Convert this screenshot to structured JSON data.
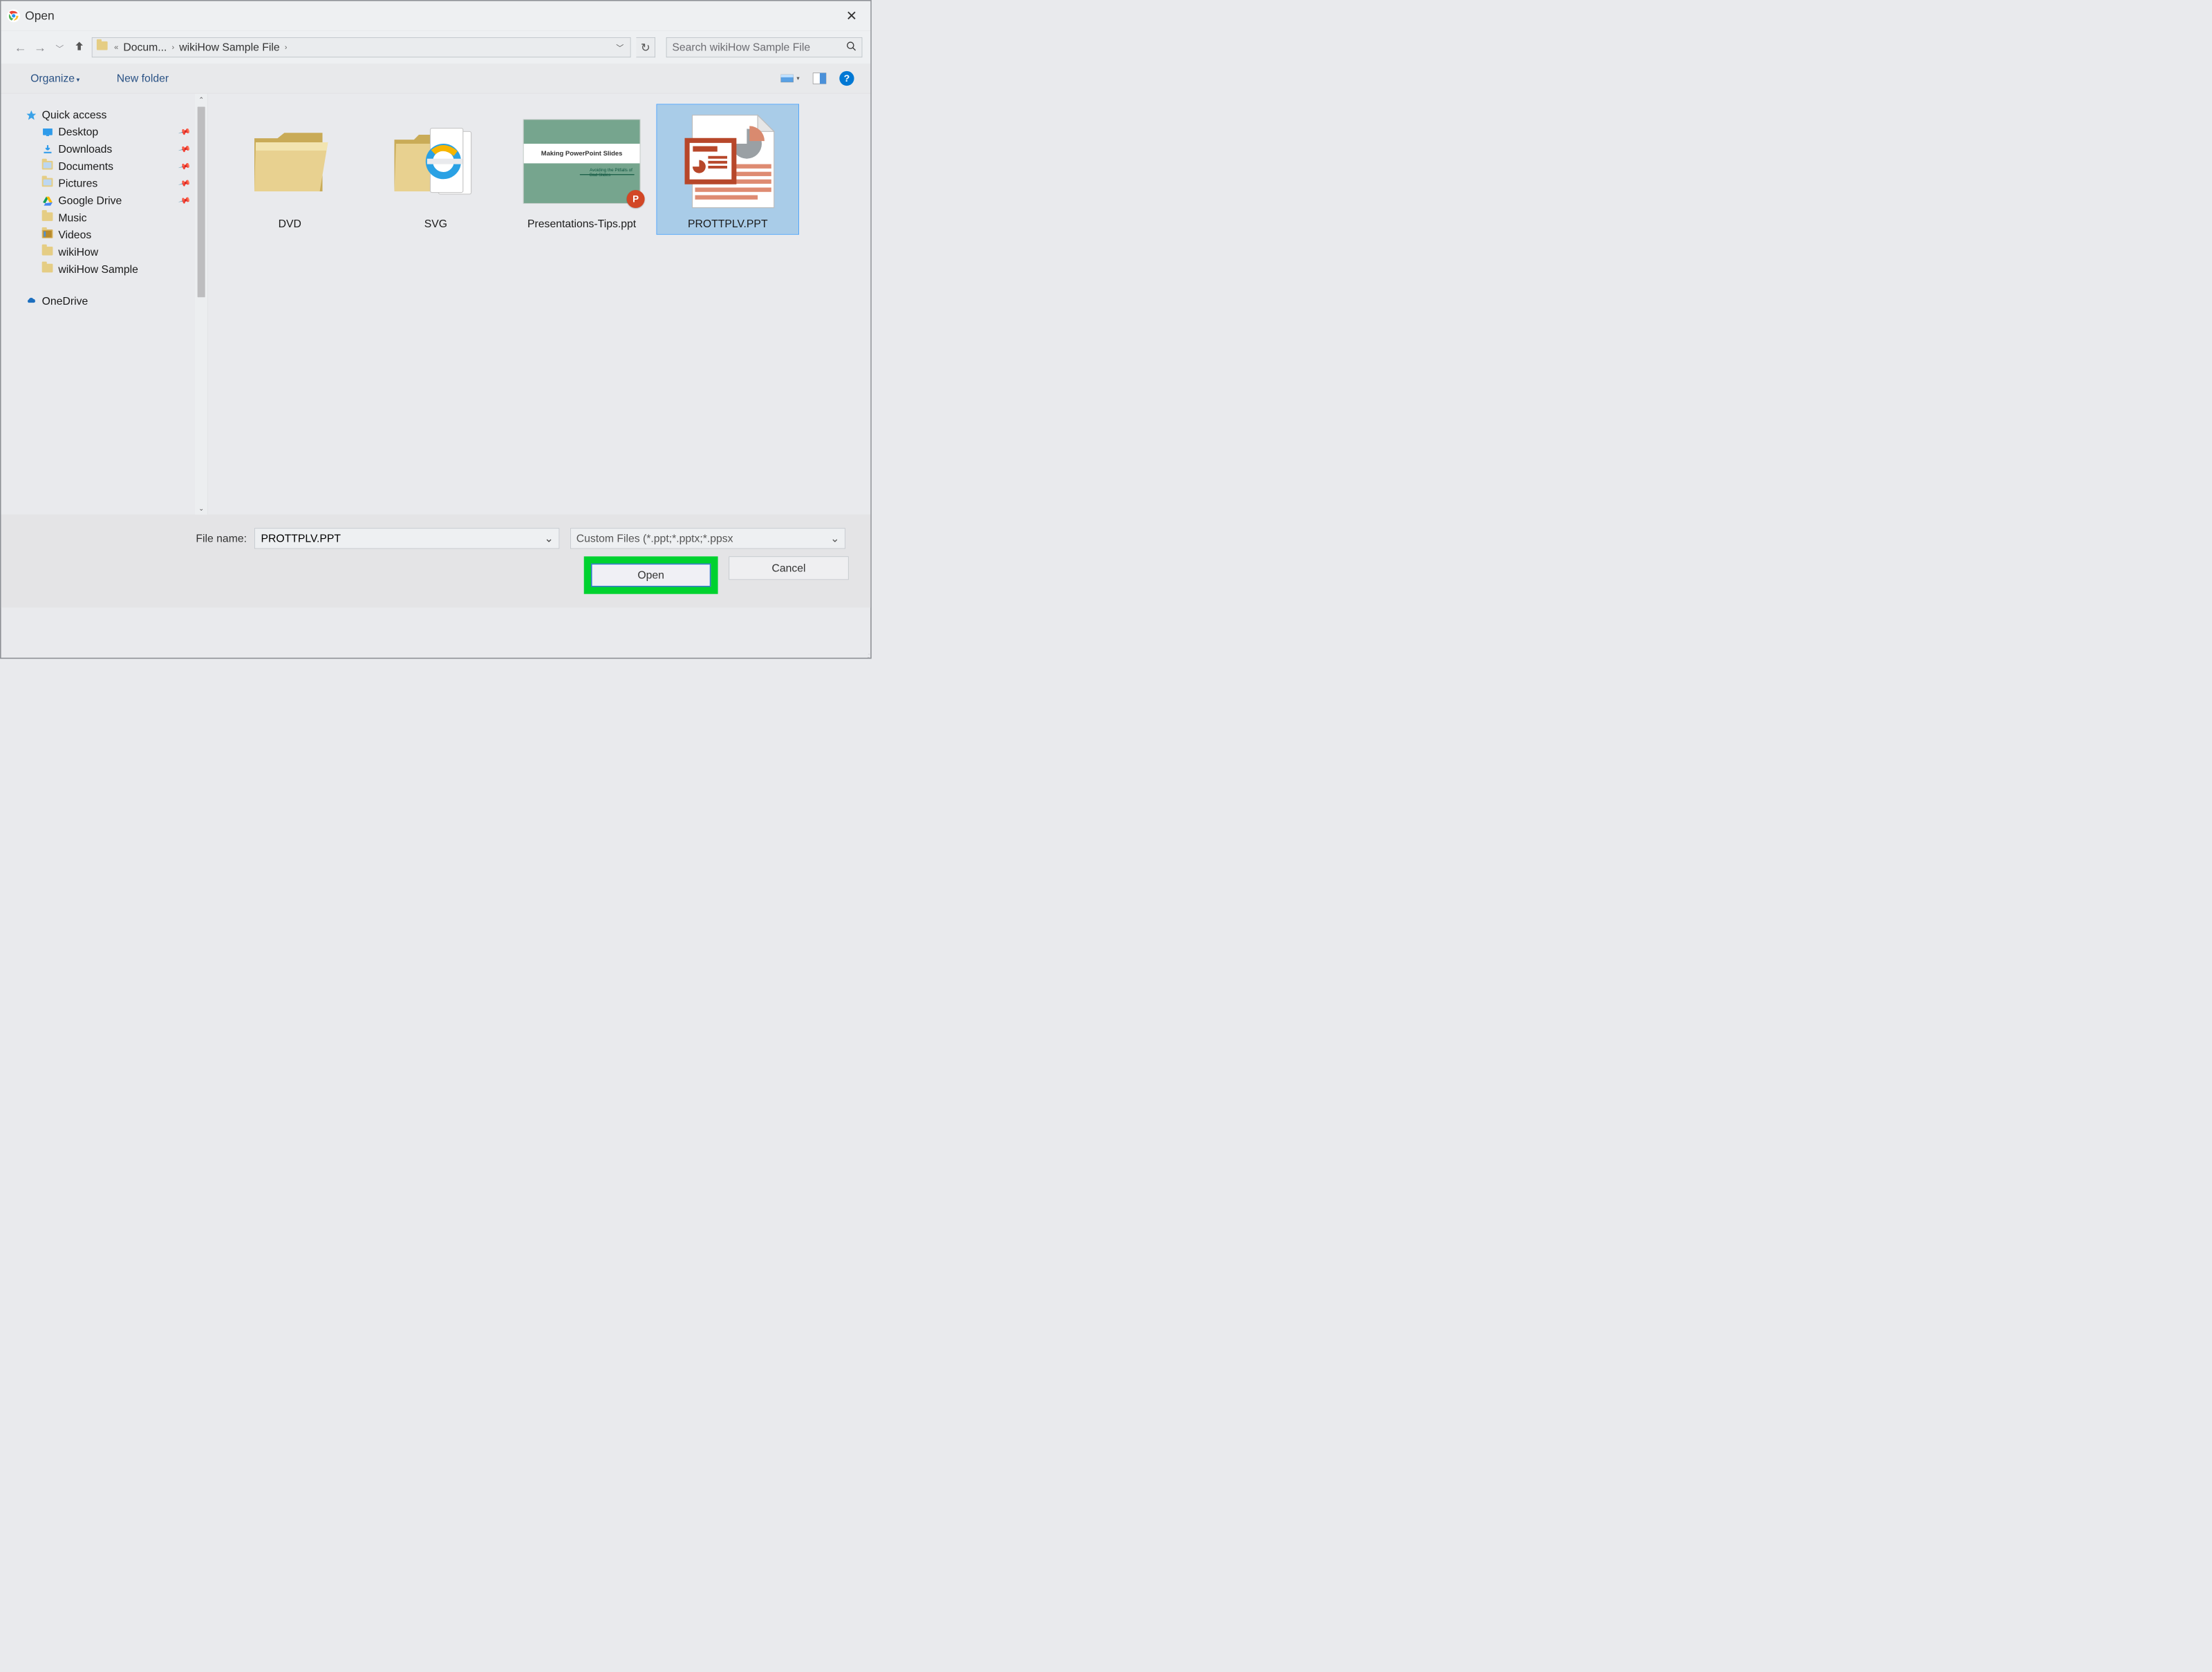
{
  "window": {
    "title": "Open"
  },
  "breadcrumb": {
    "seg1": "Docum...",
    "seg2": "wikiHow Sample File"
  },
  "search": {
    "placeholder": "Search wikiHow Sample File"
  },
  "toolbar": {
    "organize": "Organize",
    "newfolder": "New folder"
  },
  "sidebar": {
    "quick_access": "Quick access",
    "onedrive": "OneDrive",
    "items": [
      {
        "label": "Desktop",
        "pinned": true
      },
      {
        "label": "Downloads",
        "pinned": true
      },
      {
        "label": "Documents",
        "pinned": true
      },
      {
        "label": "Pictures",
        "pinned": true
      },
      {
        "label": "Google Drive",
        "pinned": true
      },
      {
        "label": "Music",
        "pinned": false
      },
      {
        "label": "Videos",
        "pinned": false
      },
      {
        "label": "wikiHow",
        "pinned": false
      },
      {
        "label": "wikiHow Sample",
        "pinned": false
      }
    ]
  },
  "files": {
    "items": [
      {
        "label": "DVD",
        "type": "folder",
        "selected": false
      },
      {
        "label": "SVG",
        "type": "folder_ie",
        "selected": false
      },
      {
        "label": "Presentations-Tips.ppt",
        "type": "ppt_thumb",
        "thumb_title": "Making PowerPoint Slides",
        "thumb_sub": "Avoiding the Pitfalls of Bad Slides",
        "selected": false
      },
      {
        "label": "PROTTPLV.PPT",
        "type": "ppt_generic",
        "selected": true
      }
    ]
  },
  "footer": {
    "filename_label": "File name:",
    "filename_value": "PROTTPLV.PPT",
    "filter": "Custom Files (*.ppt;*.pptx;*.ppsx",
    "open": "Open",
    "cancel": "Cancel"
  }
}
